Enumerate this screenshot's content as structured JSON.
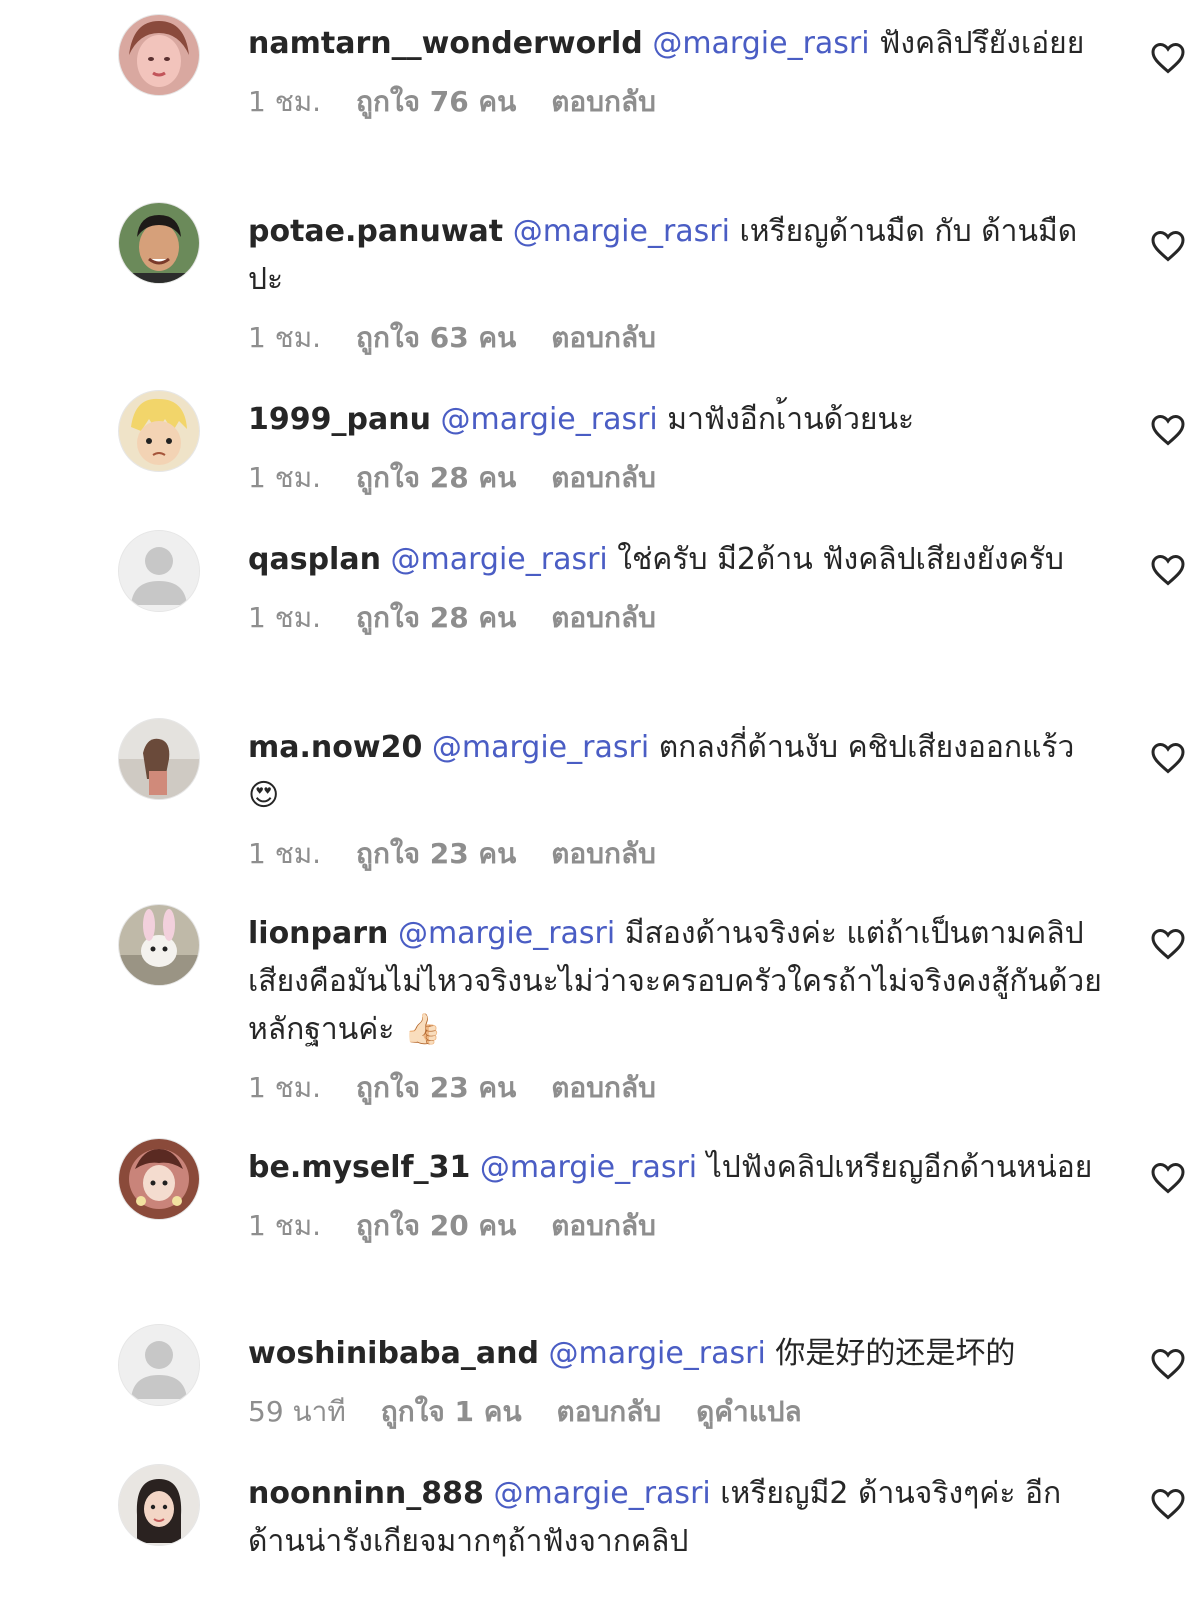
{
  "comments": [
    {
      "username": "namtarn__wonderworld",
      "mention": "@margie_rasri",
      "text": "ฟังคลิปรึยังเอ่ยย",
      "time": "1 ชม.",
      "likes": "ถูกใจ 76 คน",
      "reply": "ตอบกลับ"
    },
    {
      "username": "potae.panuwat",
      "mention": "@margie_rasri",
      "text": "เหรียญด้านมืด กับ ด้านมืด ปะ",
      "time": "1 ชม.",
      "likes": "ถูกใจ 63 คน",
      "reply": "ตอบกลับ"
    },
    {
      "username": "1999_panu",
      "mention": "@margie_rasri",
      "text": "มาฟังอีกเ้านด้วยนะ",
      "time": "1 ชม.",
      "likes": "ถูกใจ 28 คน",
      "reply": "ตอบกลับ"
    },
    {
      "username": "qasplan",
      "mention": "@margie_rasri",
      "text": "ใช่ครับ มี2ด้าน ฟังคลิปเสียงยังครับ",
      "time": "1 ชม.",
      "likes": "ถูกใจ 28 คน",
      "reply": "ตอบกลับ"
    },
    {
      "username": "ma.now20",
      "mention": "@margie_rasri",
      "text": "ตกลงกี่ด้านงับ คชิปเสียงออกแร้ว",
      "emoji": "😍",
      "time": "1 ชม.",
      "likes": "ถูกใจ 23 คน",
      "reply": "ตอบกลับ"
    },
    {
      "username": "lionparn",
      "mention": "@margie_rasri",
      "text": "มีสองด้านจริงค่ะ แต่ถ้าเป็นตามคลิปเสียงคือมันไม่ไหวจริงนะไม่ว่าจะครอบครัวใครถ้าไม่จริงคงสู้กันด้วยหลักฐานค่ะ",
      "emoji": "👍🏻",
      "time": "1 ชม.",
      "likes": "ถูกใจ 23 คน",
      "reply": "ตอบกลับ"
    },
    {
      "username": "be.myself_31",
      "mention": "@margie_rasri",
      "text": "ไปฟังคลิปเหรียญอีกด้านหน่อย",
      "time": "1 ชม.",
      "likes": "ถูกใจ 20 คน",
      "reply": "ตอบกลับ"
    },
    {
      "username": "woshinibaba_and",
      "mention": "@margie_rasri",
      "text": "你是好的还是坏的",
      "time": "59 นาที",
      "likes": "ถูกใจ 1 คน",
      "reply": "ตอบกลับ",
      "translate": "ดูคำแปล"
    },
    {
      "username": "noonninn_888",
      "mention": "@margie_rasri",
      "text": "เหรียญมี2 ด้านจริงๆค่ะ อีกด้านน่ารังเกียจมากๆถ้าฟังจากคลิป"
    }
  ],
  "icons": {
    "like": "heart-outline-icon",
    "avatar_default": "default-avatar-icon"
  },
  "colors": {
    "mention": "#4a5dc4",
    "meta": "#8e8e8e",
    "text": "#262626"
  }
}
